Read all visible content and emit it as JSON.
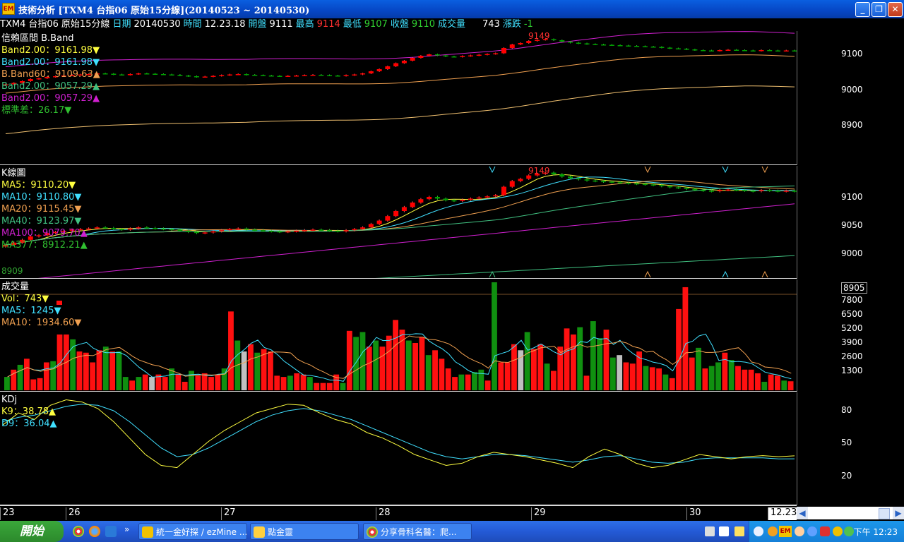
{
  "window": {
    "app_icon": "EM",
    "title": "技術分析 [TXM4 台指06 原始15分線](20140523 ~ 20140530)",
    "buttons": [
      "_",
      "❐",
      "✕"
    ]
  },
  "quote": {
    "symbol": "TXM4",
    "name": "台指06",
    "period": "原始15分線",
    "date_label": "日期",
    "date": "20140530",
    "time_label": "時間",
    "time": "12.23.18",
    "open_label": "開盤",
    "open": "9111",
    "high_label": "最高",
    "high": "9114",
    "low_label": "最低",
    "low": "9107",
    "close_label": "收盤",
    "close": "9110",
    "vol_label": "成交量",
    "vol": "743",
    "chg_label": "漲跌",
    "chg": "-1"
  },
  "colors": {
    "up": "#ff0000",
    "down": "#00a000",
    "band_upper": "#d020d0",
    "band_mid": "#f0a050",
    "band_lower": "#f0c070",
    "ma5": "#ffff40",
    "ma10": "#40e0ff",
    "ma20": "#f0a050",
    "ma40": "#40c080",
    "ma100": "#d020d0",
    "ma377": "#30c030"
  },
  "panels": {
    "band": {
      "title": "信賴區間 B.Band",
      "legend": [
        {
          "label": "Band2.00：9161.98",
          "arrow": "▼",
          "color": "#ffff40"
        },
        {
          "label": "Band2.00：9161.98",
          "arrow": "▼",
          "color": "#40e0ff"
        },
        {
          "label": "B.Band60：9109.63",
          "arrow": "▲",
          "color": "#f0a050"
        },
        {
          "label": "Band2.00：9057.29",
          "arrow": "▲",
          "color": "#40c080"
        },
        {
          "label": "Band2.00：9057.29",
          "arrow": "▲",
          "color": "#d020d0"
        },
        {
          "label": "標準差：26.17",
          "arrow": "▼",
          "color": "#30c030"
        }
      ],
      "high_mark": "9149",
      "ticks": [
        "9100",
        "9000",
        "8900"
      ]
    },
    "kline": {
      "title": "K線圖",
      "legend": [
        {
          "label": "MA5：9110.20",
          "arrow": "▼",
          "color": "#ffff40"
        },
        {
          "label": "MA10：9110.80",
          "arrow": "▼",
          "color": "#40e0ff"
        },
        {
          "label": "MA20：9115.45",
          "arrow": "▼",
          "color": "#f0a050"
        },
        {
          "label": "MA40：9123.97",
          "arrow": "▼",
          "color": "#40c080"
        },
        {
          "label": "MA100：9079.70",
          "arrow": "▲",
          "color": "#d020d0"
        },
        {
          "label": "MA377：8912.21",
          "arrow": "▲",
          "color": "#30c030"
        }
      ],
      "high_mark": "9149",
      "low_mark": "8909",
      "ticks": [
        "9100",
        "9050",
        "9000"
      ]
    },
    "volume": {
      "title": "成交量",
      "legend": [
        {
          "label": "Vol：743",
          "arrow": "▼",
          "color": "#ffff40"
        },
        {
          "label": "MA5：1245",
          "arrow": "▼",
          "color": "#40e0ff"
        },
        {
          "label": "MA10：1934.60",
          "arrow": "▼",
          "color": "#f0a050"
        }
      ],
      "ticks": [
        "8905",
        "7800",
        "6500",
        "5200",
        "3900",
        "2600",
        "1300"
      ]
    },
    "kdj": {
      "title": "KDj",
      "legend": [
        {
          "label": "K9：38.78",
          "arrow": "▲",
          "color": "#ffff40"
        },
        {
          "label": "D9：36.04",
          "arrow": "▲",
          "color": "#40e0ff"
        }
      ],
      "ticks": [
        "80",
        "50",
        "20"
      ]
    }
  },
  "time_axis": [
    "23",
    "26",
    "27",
    "28",
    "29",
    "30",
    "12.23"
  ],
  "chart_data": {
    "type": "candlestick",
    "x_labels": [
      "23",
      "26",
      "27",
      "28",
      "29",
      "30"
    ],
    "price_high": 9149,
    "price_low": 8909,
    "close": [
      9015,
      9019,
      9024,
      9030,
      9032,
      9036,
      9038,
      9040,
      9042,
      9043,
      9044,
      9046,
      9045,
      9043,
      9042,
      9044,
      9046,
      9045,
      9044,
      9043,
      9042,
      9040,
      9038,
      9036,
      9037,
      9039,
      9041,
      9043,
      9044,
      9042,
      9041,
      9040,
      9039,
      9038,
      9039,
      9040,
      9041,
      9042,
      9041,
      9040,
      9039,
      9041,
      9043,
      9046,
      9052,
      9058,
      9066,
      9075,
      9082,
      9090,
      9096,
      9100,
      9097,
      9094,
      9093,
      9095,
      9097,
      9099,
      9101,
      9103,
      9118,
      9128,
      9132,
      9138,
      9141,
      9143,
      9140,
      9136,
      9133,
      9131,
      9129,
      9128,
      9127,
      9126,
      9125,
      9124,
      9123,
      9122,
      9121,
      9119,
      9117,
      9116,
      9114,
      9112,
      9111,
      9110,
      9112,
      9113,
      9112,
      9111,
      9110,
      9112,
      9111,
      9110,
      9111,
      9110
    ],
    "volume": [
      1100,
      1700,
      2100,
      2600,
      900,
      1000,
      2300,
      2400,
      4600,
      4600,
      4200,
      3200,
      3100,
      2300,
      3300,
      3600,
      3200,
      3200,
      1100,
      800,
      1100,
      1300,
      1100,
      1300,
      1100,
      1800,
      1300,
      700,
      1600,
      1200,
      1400,
      1100,
      1300,
      1800,
      6500,
      4100,
      3200,
      3800,
      3100,
      3400,
      3200,
      1200,
      1100,
      1200,
      1400,
      1300,
      1100,
      600,
      600,
      600,
      1300,
      600,
      4900,
      4400,
      4800,
      3600,
      4100,
      3600,
      4500,
      5800,
      5000,
      4100,
      3900,
      4400,
      2900,
      3300,
      2600,
      1800,
      1100,
      1300,
      1300,
      1500,
      1700,
      800,
      8905,
      2300,
      2300,
      3800,
      3300,
      4800,
      3400,
      3800,
      2200,
      1600,
      3600,
      5100,
      4600,
      5200,
      1200,
      5700,
      4300,
      5000,
      2700,
      2900,
      2300,
      2200,
      3200,
      2000,
      1900,
      1800,
      1300,
      1000,
      6700,
      8500,
      2700,
      3500,
      1800,
      2000,
      2300,
      3100,
      2500,
      2000,
      1700,
      1700,
      1400,
      700,
      1300,
      1200,
      800,
      743
    ],
    "kdj": {
      "K": [
        67,
        78,
        72,
        85,
        90,
        88,
        82,
        70,
        55,
        40,
        30,
        28,
        40,
        52,
        62,
        70,
        78,
        82,
        86,
        85,
        78,
        72,
        68,
        60,
        55,
        48,
        40,
        35,
        30,
        32,
        38,
        42,
        40,
        38,
        35,
        32,
        28,
        38,
        45,
        40,
        32,
        28,
        30,
        35,
        40,
        38,
        36,
        38,
        39,
        38,
        38.78
      ],
      "D": [
        70,
        74,
        76,
        80,
        84,
        86,
        85,
        80,
        70,
        58,
        46,
        38,
        40,
        46,
        54,
        62,
        70,
        76,
        80,
        82,
        80,
        76,
        72,
        66,
        60,
        54,
        48,
        42,
        38,
        36,
        38,
        40,
        40,
        39,
        37,
        35,
        33,
        35,
        38,
        39,
        36,
        33,
        32,
        33,
        36,
        37,
        37,
        37,
        37,
        36,
        36.04
      ]
    }
  },
  "taskbar": {
    "start": "開始",
    "tasks": [
      "統一金好探 / ezMine ...",
      "點金靈",
      "分享骨科名醫：爬..."
    ],
    "clock": "下午 12:23",
    "tray_ime": "EM"
  }
}
